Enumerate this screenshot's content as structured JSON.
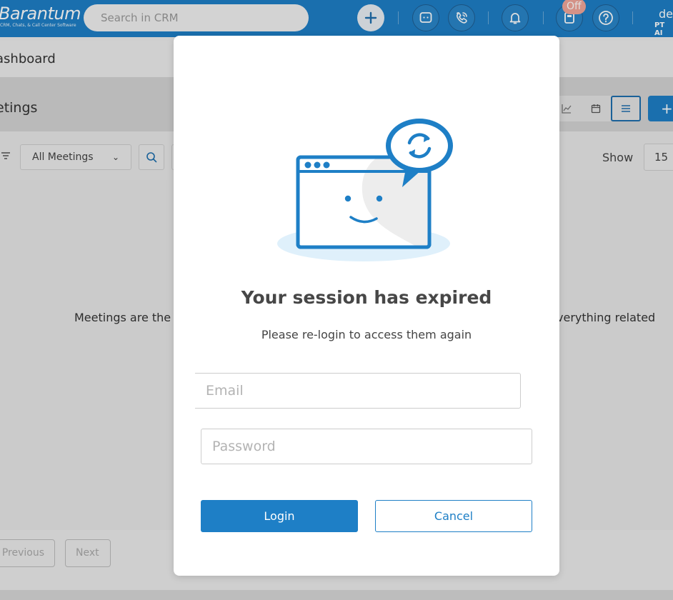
{
  "app": {
    "logo_name": "Barantum",
    "logo_tagline": "CRM, Chats, & Call Center Software"
  },
  "topbar": {
    "search_placeholder": "Search in CRM",
    "status_badge": "Off",
    "user_name": "de",
    "user_company": "PT AI"
  },
  "page": {
    "breadcrumb": "ashboard",
    "title": "etings",
    "filter_select": "All Meetings",
    "show_label": "Show",
    "show_value": "15",
    "empty_text_left": "Meetings are the",
    "empty_text_right": "verything related",
    "pager_previous": "Previous",
    "pager_next": "Next"
  },
  "modal": {
    "title": "Your session has expired",
    "subtitle": "Please re-login to access them again",
    "email_placeholder": "Email",
    "password_placeholder": "Password",
    "login_label": "Login",
    "cancel_label": "Cancel"
  },
  "colors": {
    "brand": "#1e7fc6",
    "topbar": "#1e7fc6",
    "status_off": "#f2a79a"
  },
  "icons": {
    "add": "plus-icon",
    "chat": "chat-icon",
    "phone": "phone-icon",
    "bell": "bell-icon",
    "extension": "phone-extension-icon",
    "help": "help-icon",
    "filter": "filter-icon",
    "search": "search-icon",
    "chart_view": "chart-icon",
    "calendar_view": "calendar-icon",
    "list_view": "list-icon"
  }
}
